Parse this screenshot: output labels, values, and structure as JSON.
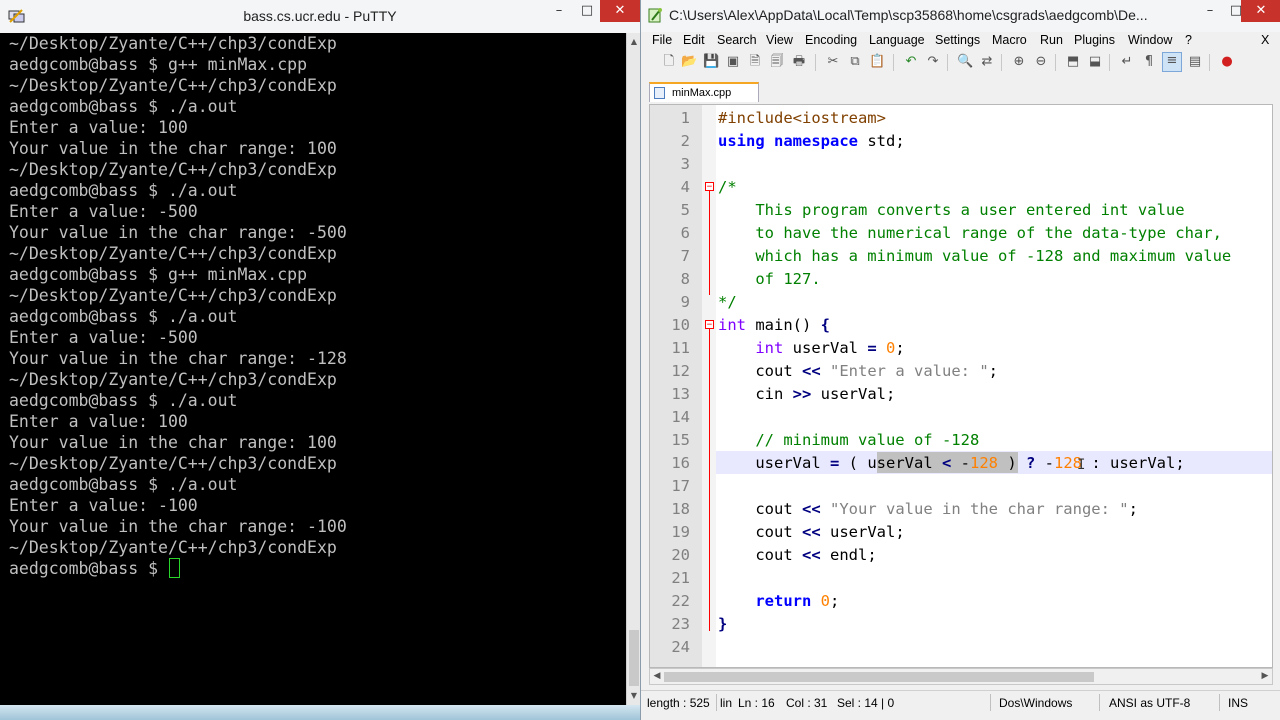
{
  "putty": {
    "title": "bass.cs.ucr.edu - PuTTY",
    "controls": {
      "minimize": "–",
      "maximize": "□",
      "close": "✕"
    },
    "terminal_lines": [
      "~/Desktop/Zyante/C++/chp3/condExp",
      "aedgcomb@bass $ g++ minMax.cpp",
      "~/Desktop/Zyante/C++/chp3/condExp",
      "aedgcomb@bass $ ./a.out",
      "Enter a value: 100",
      "Your value in the char range: 100",
      "~/Desktop/Zyante/C++/chp3/condExp",
      "aedgcomb@bass $ ./a.out",
      "Enter a value: -500",
      "Your value in the char range: -500",
      "~/Desktop/Zyante/C++/chp3/condExp",
      "aedgcomb@bass $ g++ minMax.cpp",
      "~/Desktop/Zyante/C++/chp3/condExp",
      "aedgcomb@bass $ ./a.out",
      "Enter a value: -500",
      "Your value in the char range: -128",
      "~/Desktop/Zyante/C++/chp3/condExp",
      "aedgcomb@bass $ ./a.out",
      "Enter a value: 100",
      "Your value in the char range: 100",
      "~/Desktop/Zyante/C++/chp3/condExp",
      "aedgcomb@bass $ ./a.out",
      "Enter a value: -100",
      "Your value in the char range: -100",
      "~/Desktop/Zyante/C++/chp3/condExp"
    ],
    "prompt": "aedgcomb@bass $ "
  },
  "npp": {
    "title": "C:\\Users\\Alex\\AppData\\Local\\Temp\\scp35868\\home\\csgrads\\aedgcomb\\De...",
    "controls": {
      "minimize": "–",
      "maximize": "□",
      "close": "✕"
    },
    "menu": [
      "File",
      "Edit",
      "Search",
      "View",
      "Encoding",
      "Language",
      "Settings",
      "Macro",
      "Run",
      "Plugins",
      "Window",
      "?"
    ],
    "menu_close": "X",
    "tab": {
      "label": "minMax.cpp"
    },
    "line_numbers": [
      "1",
      "2",
      "3",
      "4",
      "5",
      "6",
      "7",
      "8",
      "9",
      "10",
      "11",
      "12",
      "13",
      "14",
      "15",
      "16",
      "17",
      "18",
      "19",
      "20",
      "21",
      "22",
      "23",
      "24"
    ],
    "code": {
      "l1": "#include<iostream>",
      "l2_kw1": "using",
      "l2_kw2": "namespace",
      "l2_rest": " std;",
      "l4": "/*",
      "l5": "    This program converts a user entered int value",
      "l6": "    to have the numerical range of the data-type char,",
      "l7": "    which has a minimum value of -128 and maximum value",
      "l8": "    of 127.",
      "l9": "*/",
      "l10_type": "int",
      "l10_rest": " main() ",
      "l10_brace": "{",
      "l11_type": "int",
      "l11_rest": " userVal ",
      "l11_op": "=",
      "l11_num": "0",
      "l11_end": ";",
      "l12_a": "    cout ",
      "l12_op": "<<",
      "l12_str": "\"Enter a value: \"",
      "l12_end": ";",
      "l13_a": "    cin ",
      "l13_op": ">>",
      "l13_end": " userVal;",
      "l15": "    // minimum value of -128",
      "l16_a": "    userVal ",
      "l16_op1": "=",
      "l16_b": " ( userVal ",
      "l16_op2": "<",
      "l16_c": " -",
      "l16_num1": "128",
      "l16_d": " ) ",
      "l16_op3": "?",
      "l16_e": " -",
      "l16_num2": "128",
      "l16_f": " : userVal;",
      "l18_a": "    cout ",
      "l18_op": "<<",
      "l18_str": "\"Your value in the char range: \"",
      "l18_end": ";",
      "l19_a": "    cout ",
      "l19_op": "<<",
      "l19_end": " userVal;",
      "l20_a": "    cout ",
      "l20_op": "<<",
      "l20_end": " endl;",
      "l22_kw": "return",
      "l22_num": "0",
      "l22_end": ";",
      "l23": "}"
    },
    "status": {
      "length": "length : 525",
      "line": "Ln : 16",
      "line_prefix": "lin",
      "col": "Col : 31",
      "sel": "Sel : 14 | 0",
      "eol": "Dos\\Windows",
      "encoding": "ANSI as UTF-8",
      "mode": "INS"
    }
  }
}
